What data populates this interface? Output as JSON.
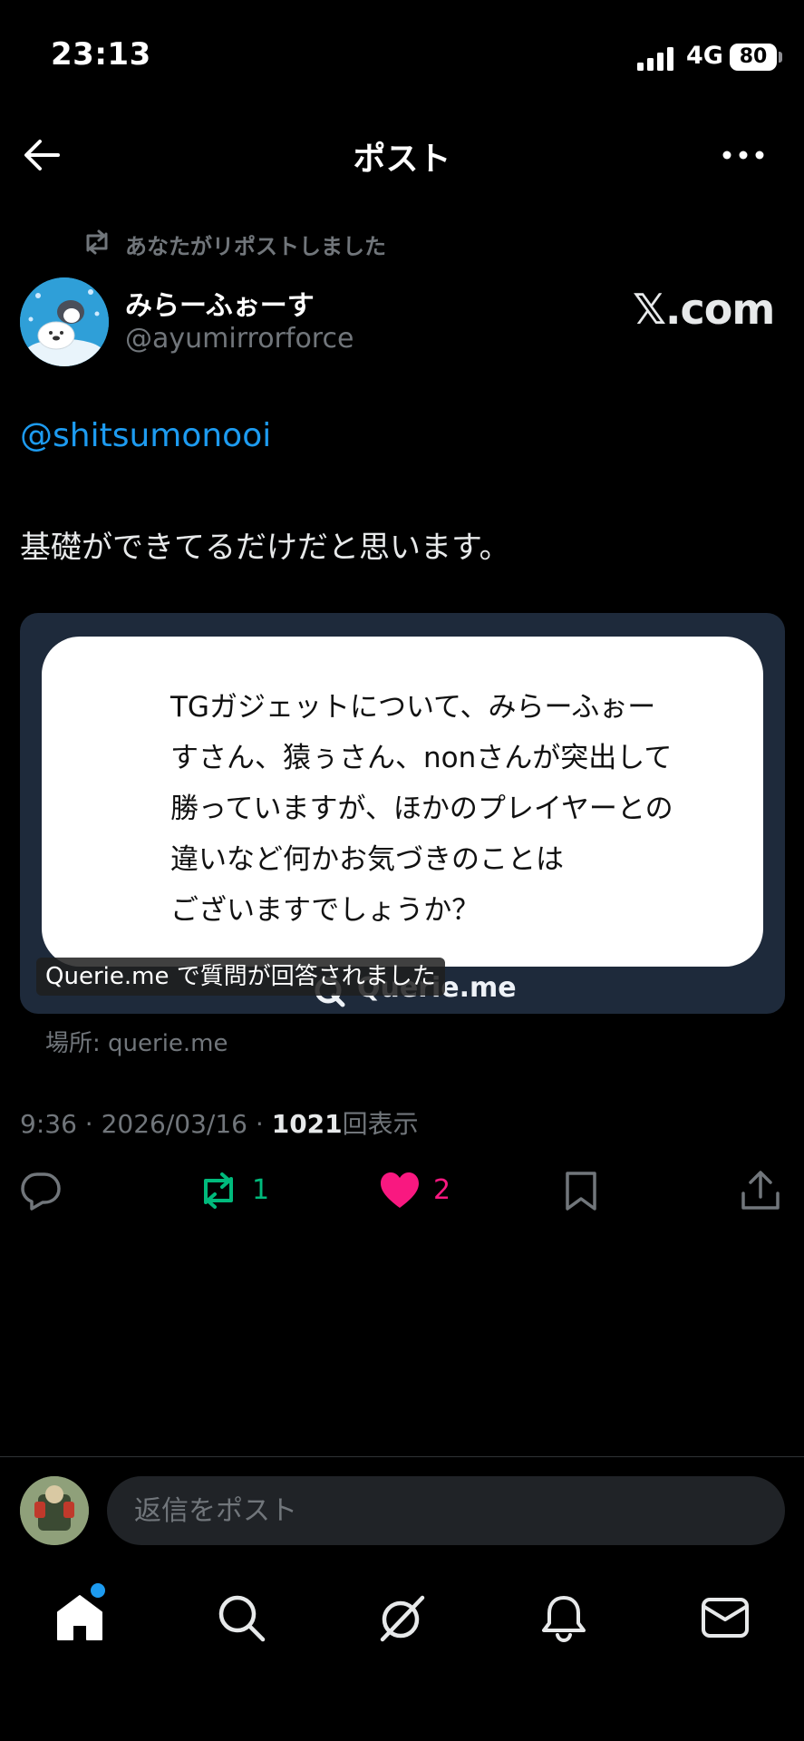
{
  "status_bar": {
    "time": "23:13",
    "network": "4G",
    "battery": "80"
  },
  "header": {
    "title": "ポスト"
  },
  "repost_context": {
    "text": "あなたがリポストしました"
  },
  "author": {
    "display_name": "みらーふぉーす",
    "handle": "@ayumirrorforce",
    "source_badge": "𝕏.com"
  },
  "post": {
    "mention": "@shitsumonooi",
    "text": "基礎ができてるだけだと思います。"
  },
  "card": {
    "lines": [
      "TGガジェットについて、みらーふぉー",
      "すさん、猿ぅさん、nonさんが突出して",
      "勝っていますが、ほかのプレイヤーとの",
      "違いなど何かお気づきのことは",
      "ございますでしょうか？"
    ],
    "logo_text": "Querie.me",
    "caption": "Querie.me で質問が回答されました",
    "domain": "場所: querie.me"
  },
  "meta": {
    "time": "9:36",
    "separator": "·",
    "date": "2026/03/16",
    "views": "1021",
    "views_label": "回表示"
  },
  "actions": {
    "reposts": "1",
    "likes": "2"
  },
  "reply": {
    "placeholder": "返信をポスト"
  },
  "colors": {
    "accent": "#1d9bf0",
    "repost": "#00ba7c",
    "like": "#f91880",
    "card_bg": "#1e2a3b"
  }
}
